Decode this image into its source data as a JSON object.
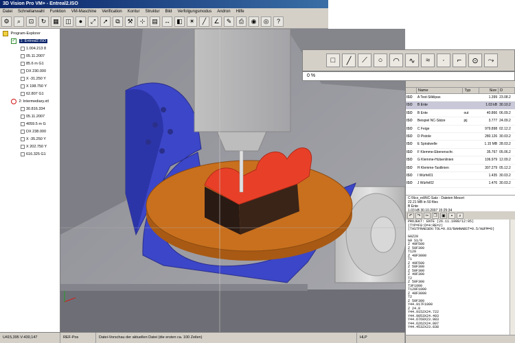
{
  "window": {
    "title": "3D Vision Pro VM+ - Entreal2.ISO"
  },
  "menu": [
    "Datei",
    "Schnellanwahl",
    "Funktion",
    "VM-Maschine",
    "Verification",
    "Kontur",
    "Struktur",
    "Bild",
    "Verfolgungsmodus",
    "Andron",
    "Hilfe"
  ],
  "toolbar_icons": [
    "gear-icon",
    "magnifier-icon",
    "zoom-fit-icon",
    "rotate-icon",
    "palette-icon",
    "cube-icon",
    "sphere-icon",
    "fit-icon",
    "arrow-icon",
    "split-icon",
    "tool-icon",
    "axis-icon",
    "grid-icon",
    "measure-icon",
    "section-icon",
    "light-icon",
    "line-icon",
    "angle-icon",
    "pen-icon",
    "print-icon",
    "camera-icon",
    "target-icon",
    "help-icon"
  ],
  "explorer": {
    "root": "Program-Explorer",
    "item1": "1: Entreal2.ISO",
    "item1_rows": [
      "1.004.213  8",
      "05.11.2007",
      "85.6 m  G1",
      "DX 230.000",
      "X -31.250 Y",
      "X 198.750 Y",
      "62.807  G1"
    ],
    "item2": "2: Intermediary.xtl",
    "item2_rows": [
      "30.816.334",
      "05.11.2007",
      "4059.5 m  G",
      "DX 238.000",
      "X -35.250 Y",
      "X 202.750 Y",
      "616.325  G1"
    ]
  },
  "panel": {
    "tool_icons": [
      "square-icon",
      "line-tool-icon",
      "polyline-icon",
      "circle-icon",
      "arc-icon",
      "curve-icon",
      "spline-icon",
      "point-icon",
      "corner-icon",
      "node-icon",
      "path-icon"
    ],
    "percent": "0 %"
  },
  "files": {
    "headers": [
      "",
      "Name",
      "Typ",
      "Size",
      "D"
    ],
    "rows": [
      {
        "tag": "ISO",
        "name": "A Test-Silklipas",
        "typ": "",
        "size": "1.399",
        "date": "23.08.2"
      },
      {
        "tag": "ISO",
        "name": "B Ente",
        "typ": "",
        "size": "1.03 kB",
        "date": "30.10.2"
      },
      {
        "tag": "ISO",
        "name": "B Ente",
        "typ": "out",
        "size": "40.866",
        "date": "06.09.2"
      },
      {
        "tag": "ISO",
        "name": "Beispiel NC-Sätze",
        "typ": "pij",
        "size": "3.777",
        "date": "24.09.2"
      },
      {
        "tag": "ISO",
        "name": "C Feige",
        "typ": "",
        "size": "979.898",
        "date": "02.12.2"
      },
      {
        "tag": "ISO",
        "name": "D Pistole",
        "typ": "",
        "size": "280.126",
        "date": "30.03.2"
      },
      {
        "tag": "ISO",
        "name": "E Spiralwelle",
        "typ": "",
        "size": "1.15 MB",
        "date": "28.03.2"
      },
      {
        "tag": "ISO",
        "name": "F Klemme-Ebenenschr.",
        "typ": "",
        "size": "35.767",
        "date": "05.06.2"
      },
      {
        "tag": "ISO",
        "name": "G Klemme-Hülsenlinien",
        "typ": "",
        "size": "106.979",
        "date": "12.09.2"
      },
      {
        "tag": "ISO",
        "name": "H Klemme-Tastlinien",
        "typ": "",
        "size": "307.279",
        "date": "05.12.2"
      },
      {
        "tag": "ISO",
        "name": "I Würfel01",
        "typ": "",
        "size": "1.435",
        "date": "30.03.2"
      },
      {
        "tag": "ISO",
        "name": "J Würfel02",
        "typ": "",
        "size": "1.476",
        "date": "30.03.2"
      }
    ],
    "selected_index": 1
  },
  "fileinfo": [
    "C:\\Nco_ed\\NC-Satz - Dateien Messrt",
    "22.21 MB in 50 files",
    "B Ente",
    "1.03 kB   30.10.2007 15:25:34"
  ],
  "editor": {
    "tool_icons": [
      "undo-icon",
      "redo-icon",
      "cut-icon",
      "copy-icon",
      "paste-icon",
      "save-icon",
      "find-icon"
    ],
    "lines": [
      "PROJEKT: ENTE (26.11.1998/12:05)",
      "(TYP=F0:D=4:RE=2)",
      "(TASTFRAESEN:TOL=0.03/BAHNABST=0.5/AUFM=0)",
      "",
      "G0Z20",
      "G0 S1/0",
      "Z 49F500",
      "Z 50F300",
      "T120",
      "Z 48F3000",
      "T1",
      "Z 49F500",
      "Z 50F300",
      "Z 50F300",
      "Z 49F300",
      "T2",
      "Z 50F300",
      "T3F1000",
      "T120F1000",
      "Z 48F3000",
      "T2",
      "Z 50F300",
      "Y44.917F1000",
      "Z 24.8",
      "Y44.9152X24.722",
      "Y44.9053X24.403",
      "Y44.6769X23.983",
      "Y44.6262X24.007",
      "Y44.4532X23.838"
    ]
  },
  "status": {
    "coords": "U415,395   V-430,147",
    "pos": "REF-Pos",
    "message": "Datei-Vorschau der aktuellen Datei (die ersten ca. 100 Zeilen)",
    "mode": "HLP"
  },
  "colors": {
    "title_bg": "#0a246a",
    "panel_gray": "#d4d0c8",
    "viewport_bg": "#9a9aa0",
    "fixture_blue": "#3c46c8",
    "table_orange": "#c8701e",
    "part_red": "#e84028",
    "spindle_gray": "#b4b4b4"
  }
}
